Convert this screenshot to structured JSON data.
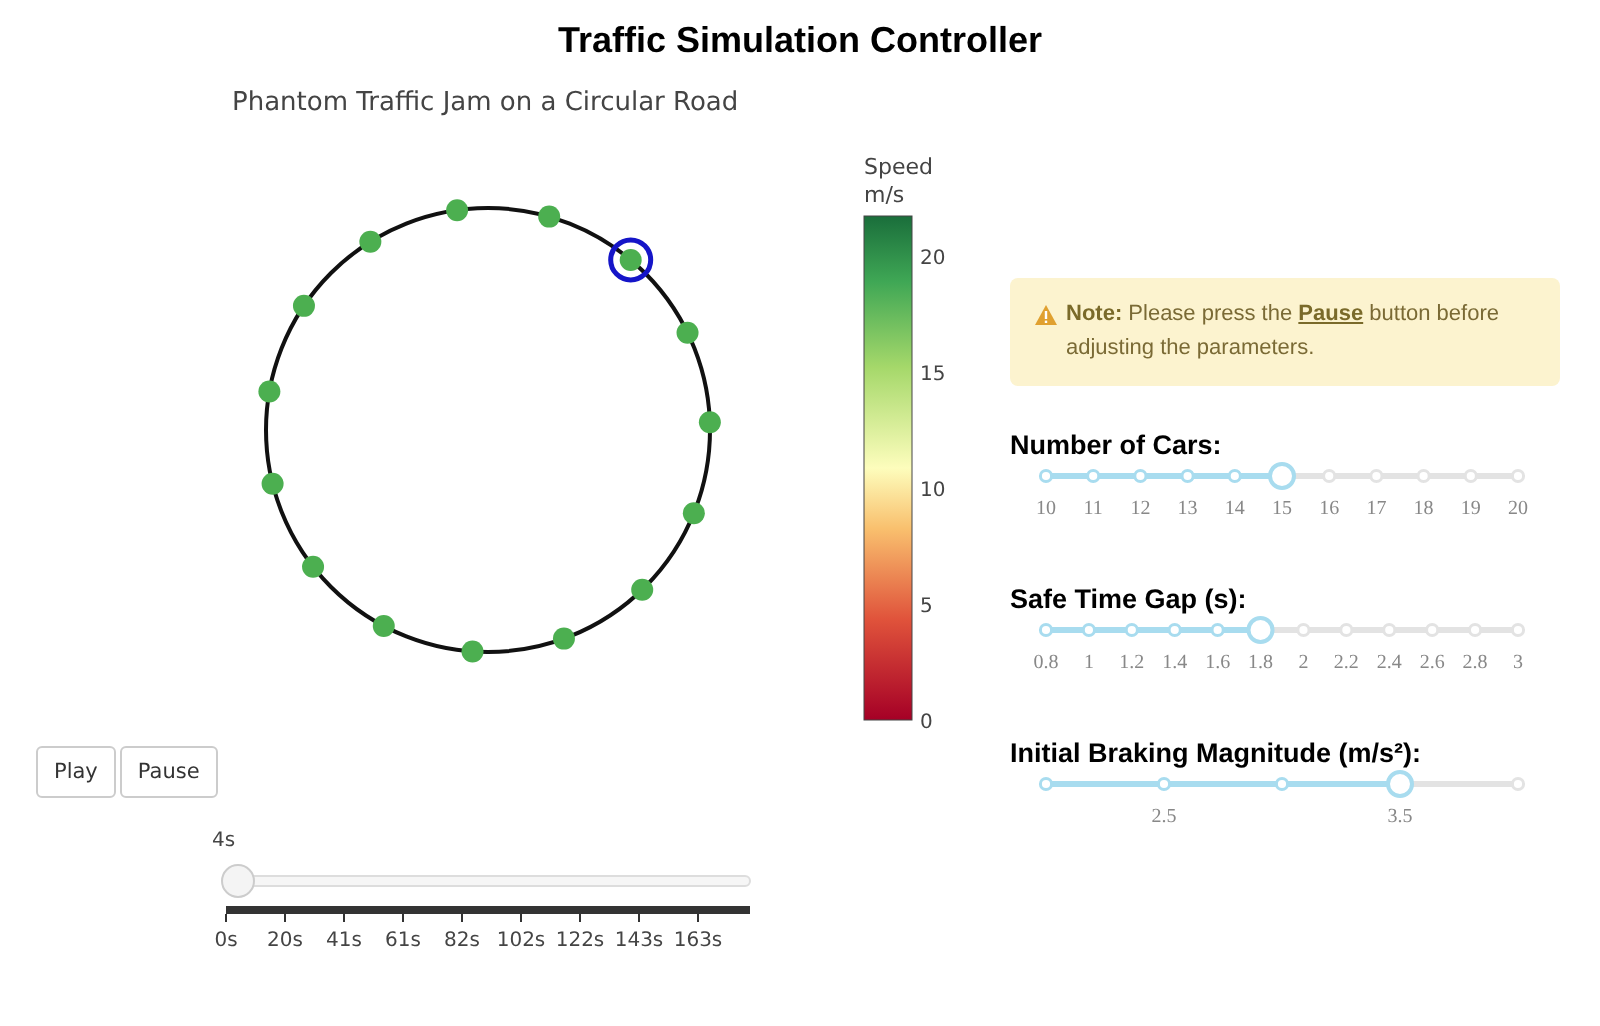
{
  "title": "Traffic Simulation Controller",
  "plot": {
    "title": "Phantom Traffic Jam on a Circular Road",
    "cars": [
      {
        "selected": false
      },
      {
        "selected": false
      },
      {
        "selected": true
      },
      {
        "selected": false
      },
      {
        "selected": false
      },
      {
        "selected": false
      },
      {
        "selected": false
      },
      {
        "selected": false
      },
      {
        "selected": false
      },
      {
        "selected": false
      },
      {
        "selected": false
      },
      {
        "selected": false
      },
      {
        "selected": false
      },
      {
        "selected": false
      },
      {
        "selected": false
      }
    ],
    "colorbar": {
      "title": "Speed",
      "unit": "m/s",
      "ticks": [
        "20",
        "15",
        "10",
        "5",
        "0"
      ]
    }
  },
  "controls": {
    "buttons": [
      "Play",
      "Pause"
    ],
    "time_slider": {
      "current": "4s",
      "level": 0,
      "ticks": [
        "0s",
        "20s",
        "41s",
        "61s",
        "82s",
        "102s",
        "122s",
        "143s",
        "163s"
      ]
    }
  },
  "note": "**Note:** Please press the **Pause** button before adjusting the parameters.",
  "sliders": [
    {
      "label": "Number of Cars:",
      "level": 0.5,
      "steps": [
        {
          "label": "10"
        },
        {
          "label": "11"
        },
        {
          "label": "12"
        },
        {
          "label": "13"
        },
        {
          "label": "14"
        },
        {
          "label": "15"
        },
        {
          "label": "16"
        },
        {
          "label": "17"
        },
        {
          "label": "18"
        },
        {
          "label": "19"
        },
        {
          "label": "20"
        }
      ]
    },
    {
      "label": "Safe Time Gap (s):",
      "level": 0.4545,
      "steps": [
        {
          "label": "0.8"
        },
        {
          "label": "1"
        },
        {
          "label": "1.2"
        },
        {
          "label": "1.4"
        },
        {
          "label": "1.6"
        },
        {
          "label": "1.8"
        },
        {
          "label": "2"
        },
        {
          "label": "2.2"
        },
        {
          "label": "2.4"
        },
        {
          "label": "2.6"
        },
        {
          "label": "2.8"
        },
        {
          "label": "3"
        }
      ]
    },
    {
      "label": "Initial Braking Magnitude (m/s²):",
      "level": 0.75,
      "steps": [
        {
          "kind": "dot"
        },
        {
          "kind": "labeled",
          "label": "2.5"
        },
        {
          "kind": "dot"
        },
        {
          "kind": "labeled",
          "label": "3.5"
        },
        {
          "kind": "dot"
        }
      ]
    }
  ]
}
